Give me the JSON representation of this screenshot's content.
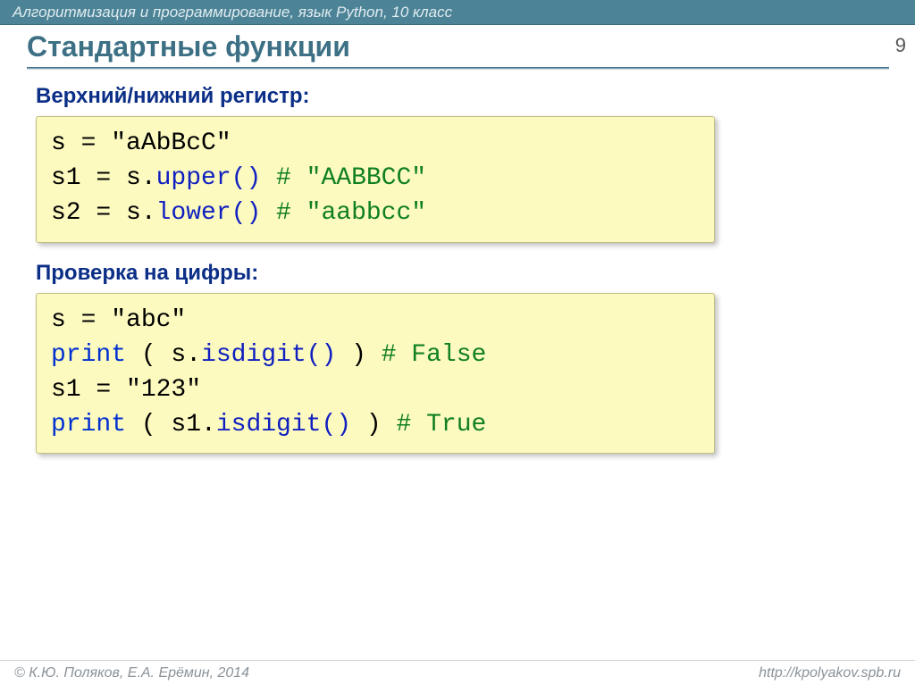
{
  "header": {
    "course_line": "Алгоритмизация и программирование, язык Python, 10 класс"
  },
  "page_number": "9",
  "title": "Стандартные функции",
  "section1": {
    "heading": "Верхний/нижний регистр:",
    "line1_a": "s = ",
    "line1_b": "\"aAbBcC\"",
    "line2_a": "s1 = s.",
    "line2_b": "upper()",
    "line2_c": "   # \"AABBCC\"",
    "line3_a": "s2 = s.",
    "line3_b": "lower()",
    "line3_c": "   # \"aabbcc\""
  },
  "section2": {
    "heading": "Проверка на цифры:",
    "line1_a": "s = ",
    "line1_b": "\"abc\"",
    "line2_a": "print",
    "line2_b": " ( s.",
    "line2_c": "isdigit()",
    "line2_d": " )   ",
    "line2_e": "# False",
    "line3_a": "s1 = ",
    "line3_b": "\"123\"",
    "line4_a": "print",
    "line4_b": " ( s1.",
    "line4_c": "isdigit()",
    "line4_d": " )  ",
    "line4_e": "# True"
  },
  "footer": {
    "left": "© К.Ю. Поляков, Е.А. Ерёмин, 2014",
    "right": "http://kpolyakov.spb.ru"
  }
}
